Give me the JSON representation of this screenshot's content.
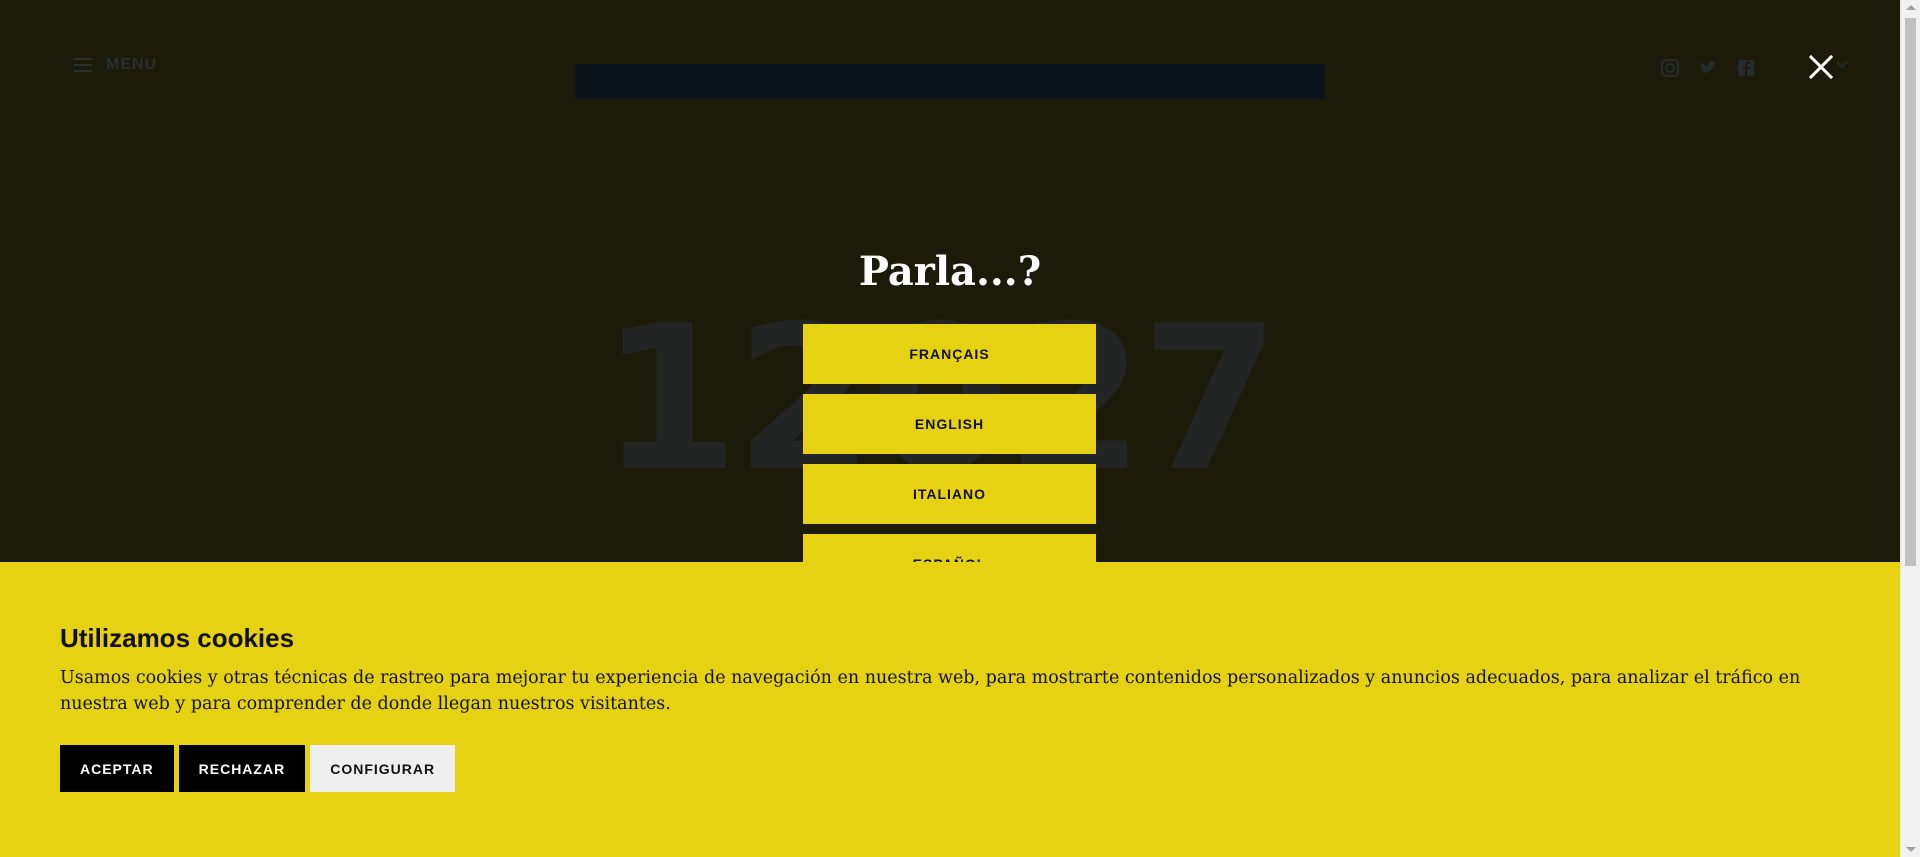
{
  "header": {
    "menu_label": "MENU",
    "logo_text": "",
    "social_icons": [
      "instagram-icon",
      "twitter-icon",
      "facebook-icon"
    ]
  },
  "background": {
    "big_number": "12027"
  },
  "language_modal": {
    "title": "Parla...?",
    "options": [
      "FRANÇAIS",
      "ENGLISH",
      "ITALIANO",
      "ESPAÑOL"
    ],
    "close_icon": "close-icon"
  },
  "cookie_banner": {
    "title": "Utilizamos cookies",
    "text": "Usamos cookies y otras técnicas de rastreo para mejorar tu experiencia de navegación en nuestra web, para mostrarte contenidos personalizados y anuncios adecuados, para analizar el tráfico en nuestra web y para comprender de donde llegan nuestros visitantes.",
    "accept_label": "ACEPTAR",
    "reject_label": "RECHAZAR",
    "configure_label": "CONFIGURAR"
  },
  "colors": {
    "accent_yellow": "#e6d113",
    "overlay_dark": "#1c1a08",
    "button_dark": "#000000"
  }
}
